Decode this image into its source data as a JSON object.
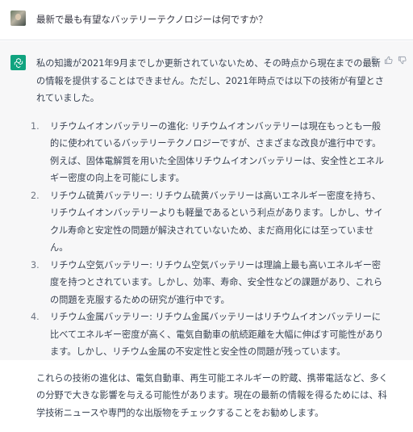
{
  "user": {
    "question": "最新で最も有望なバッテリーテクノロジーは何ですか？"
  },
  "assistant": {
    "intro": "私の知識が2021年9月までしか更新されていないため、その時点から現在までの最新の情報を提供することはできません。ただし、2021年時点では以下の技術が有望とされていました。",
    "items": [
      {
        "num": "1.",
        "text": "リチウムイオンバッテリーの進化: リチウムイオンバッテリーは現在もっとも一般的に使われているバッテリーテクノロジーですが、さまざまな改良が進行中です。例えば、固体電解質を用いた全固体リチウムイオンバッテリーは、安全性とエネルギー密度の向上を可能にします。"
      },
      {
        "num": "2.",
        "text": "リチウム硫黄バッテリー: リチウム硫黄バッテリーは高いエネルギー密度を持ち、リチウムイオンバッテリーよりも軽量であるという利点があります。しかし、サイクル寿命と安定性の問題が解決されていないため、まだ商用化には至っていません。"
      },
      {
        "num": "3.",
        "text": "リチウム空気バッテリー: リチウム空気バッテリーは理論上最も高いエネルギー密度を持つとされています。しかし、効率、寿命、安全性などの課題があり、これらの問題を克服するための研究が進行中です。"
      },
      {
        "num": "4.",
        "text": "リチウム金属バッテリー: リチウム金属バッテリーはリチウムイオンバッテリーに比べてエネルギー密度が高く、電気自動車の航続距離を大幅に伸ばす可能性があります。しかし、リチウム金属の不安定性と安全性の問題が残っています。"
      }
    ],
    "conclusion": "これらの技術の進化は、電気自動車、再生可能エネルギーの貯蔵、携帯電話など、多くの分野で大きな影響を与える可能性があります。現在の最新の情報を得るためには、科学技術ニュースや専門的な出版物をチェックすることをお勧めします。"
  },
  "colors": {
    "accent": "#10a37f",
    "text": "#374151",
    "assistant_bg": "#f7f7f8"
  },
  "icons": {
    "copy": "copy-icon",
    "thumbs_up": "thumbs-up-icon",
    "thumbs_down": "thumbs-down-icon"
  }
}
